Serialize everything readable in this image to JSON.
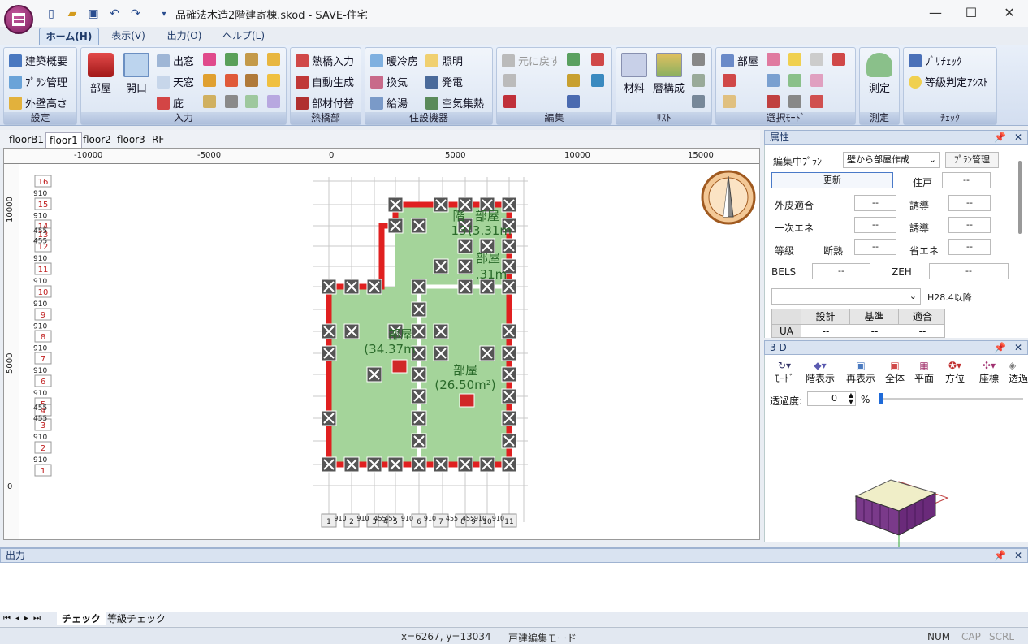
{
  "window": {
    "title": "品確法木造2階建寄棟.skod - SAVE-住宅",
    "controls": [
      "—",
      "☐",
      "✕"
    ]
  },
  "ribbon_tabs": [
    {
      "label": "ホーム(H)"
    },
    {
      "label": "表示(V)"
    },
    {
      "label": "出力(O)"
    },
    {
      "label": "ヘルプ(L)"
    }
  ],
  "ribbon": {
    "settings": {
      "caption": "設定",
      "items": [
        "建築概要",
        "ﾌﾟﾗﾝ管理",
        "外壁高さ"
      ]
    },
    "input": {
      "caption": "入力",
      "room": "部屋",
      "opening": "開口",
      "items": [
        "出窓",
        "天窓",
        "庇"
      ]
    },
    "thermal_bridge": {
      "caption": "熱橋部",
      "items": [
        "熱橋入力",
        "自動生成",
        "部材付替"
      ]
    },
    "equipment": {
      "caption": "住設機器",
      "items": [
        "暖冷房",
        "換気",
        "給湯",
        "照明",
        "発電",
        "空気集熱"
      ]
    },
    "edit": {
      "caption": "編集",
      "undo": "元に戻す"
    },
    "list": {
      "caption": "ﾘｽﾄ",
      "material": "材料",
      "layers": "層構成"
    },
    "select_mode": {
      "caption": "選択ﾓｰﾄﾞ",
      "room": "部屋"
    },
    "measure": {
      "caption": "測定",
      "label": "測定"
    },
    "check": {
      "caption": "ﾁｪｯｸ",
      "items": [
        "ﾌﾟﾘﾁｪｯｸ",
        "等級判定ｱｼｽﾄ"
      ]
    }
  },
  "doc_tabs": [
    "floorB1",
    "floor1",
    "floor2",
    "floor3",
    "RF"
  ],
  "canvas": {
    "hruler_labels": [
      "-10000",
      "-5000",
      "0",
      "5000",
      "10000",
      "15000"
    ],
    "vruler_labels": [
      "10000",
      "5000",
      "0"
    ],
    "row_markers": [
      "16",
      "15",
      "14",
      "13",
      "12",
      "11",
      "10",
      "9",
      "8",
      "7",
      "6",
      "5",
      "4",
      "3",
      "2",
      "1"
    ],
    "row_gaps": [
      "910",
      "910",
      "455",
      "455",
      "910",
      "910",
      "910",
      "910",
      "910",
      "910",
      "910",
      "455",
      "455",
      "910",
      "910"
    ],
    "col_markers": [
      "1",
      "2",
      "3",
      "4",
      "5",
      "6",
      "7",
      "8",
      "9",
      "10",
      "11"
    ],
    "col_gaps": [
      "910",
      "910",
      "455",
      "455",
      "910",
      "910",
      "455",
      "455",
      "910",
      "910"
    ],
    "rooms": [
      {
        "name": "部屋",
        "area": "(34.37m"
      },
      {
        "name": "部屋",
        "area": "(26.50m²)"
      },
      {
        "name": "部屋",
        "area": ".31m"
      },
      {
        "name": "部屋",
        "area": "(3.31m"
      },
      {
        "name": "階",
        "area": "13"
      }
    ]
  },
  "properties": {
    "title": "属性",
    "edit_plan_label": "編集中ﾌﾟﾗﾝ",
    "edit_plan_value": "壁から部屋作成",
    "plan_mgmt_button": "ﾌﾟﾗﾝ管理",
    "update_button": "更新",
    "rows": [
      {
        "label": "住戸",
        "value": "--"
      },
      {
        "label": "外皮適合",
        "value": "--",
        "label2": "誘導",
        "value2": "--"
      },
      {
        "label": "一次エネ",
        "value": "--",
        "label2": "誘導",
        "value2": "--"
      },
      {
        "label": "等級",
        "sub": "断熱",
        "value": "--",
        "label2": "省エネ",
        "value2": "--"
      },
      {
        "label": "BELS",
        "value": "--",
        "label2": "ZEH",
        "value2": "--"
      }
    ],
    "standard_label": "H28.4以降",
    "table_headers": [
      "設計",
      "基準",
      "適合"
    ],
    "table_row_label": "UA",
    "table_row_values": [
      "--",
      "--",
      "--"
    ]
  },
  "view3d": {
    "title": "3 D",
    "buttons": [
      "ﾓｰﾄﾞ",
      "階表示",
      "再表示",
      "全体",
      "平面",
      "方位",
      "座標",
      "透過"
    ],
    "transparency_label": "透過度:",
    "transparency_value": "0",
    "unit": "%"
  },
  "output": {
    "title": "出力",
    "tabs": [
      "チェック",
      "等級チェック"
    ]
  },
  "status": {
    "coords": "x=6267, y=13034",
    "mode": "戸建編集モード",
    "num": "NUM",
    "cap": "CAP",
    "scrl": "SCRL"
  }
}
